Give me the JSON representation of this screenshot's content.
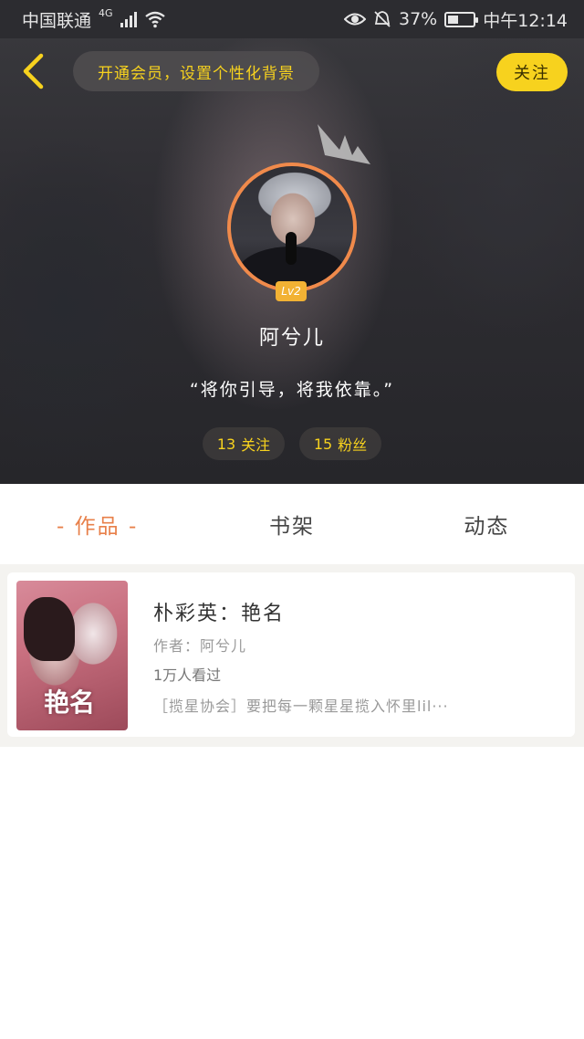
{
  "status_bar": {
    "carrier": "中国联通",
    "network": "4G",
    "battery_percent": "37%",
    "time": "中午12:14",
    "battery_level": 0.37
  },
  "header": {
    "promo_text": "开通会员，设置个性化背景",
    "follow_label": "关注"
  },
  "profile": {
    "level": "Lv2",
    "username": "阿兮儿",
    "motto": "“将你引导，将我依靠。”",
    "following_count": "13",
    "following_label": "关注",
    "fans_count": "15",
    "fans_label": "粉丝"
  },
  "tabs": [
    {
      "label": "- 作品 -",
      "active": true
    },
    {
      "label": "书架",
      "active": false
    },
    {
      "label": "动态",
      "active": false
    }
  ],
  "works": [
    {
      "cover_text": "艳名",
      "title": "朴彩英：艳名",
      "author": "作者：阿兮儿",
      "reads": "1万人看过",
      "description": "［揽星协会］要把每一颗星星揽入怀里lil···"
    }
  ],
  "colors": {
    "accent_yellow": "#f7d21e",
    "tab_active": "#e8804a",
    "avatar_ring": "#f08a4b"
  }
}
